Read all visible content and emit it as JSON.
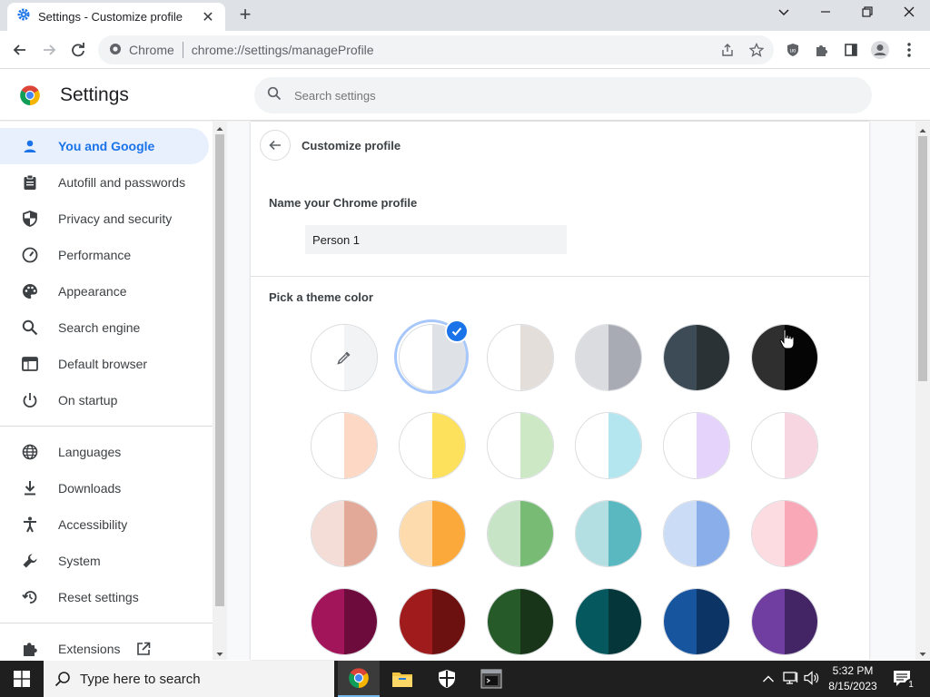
{
  "window": {
    "tab_title": "Settings - Customize profile",
    "tab_close": "✕",
    "new_tab": "+",
    "minimize": "⌄",
    "maximize": "—",
    "restore": "❐",
    "close": "✕"
  },
  "toolbar": {
    "chip_label": "Chrome",
    "url_scheme": "chrome://",
    "url_path": "settings/manageProfile"
  },
  "settings": {
    "title": "Settings",
    "search_placeholder": "Search settings"
  },
  "sidebar": {
    "items": [
      {
        "label": "You and Google",
        "icon": "person-icon",
        "active": true
      },
      {
        "label": "Autofill and passwords",
        "icon": "clipboard-icon"
      },
      {
        "label": "Privacy and security",
        "icon": "shield-icon"
      },
      {
        "label": "Performance",
        "icon": "gauge-icon"
      },
      {
        "label": "Appearance",
        "icon": "palette-icon"
      },
      {
        "label": "Search engine",
        "icon": "search-icon"
      },
      {
        "label": "Default browser",
        "icon": "browser-icon"
      },
      {
        "label": "On startup",
        "icon": "power-icon"
      },
      {
        "label": "Languages",
        "icon": "globe-icon"
      },
      {
        "label": "Downloads",
        "icon": "download-icon"
      },
      {
        "label": "Accessibility",
        "icon": "accessibility-icon"
      },
      {
        "label": "System",
        "icon": "wrench-icon"
      },
      {
        "label": "Reset settings",
        "icon": "reset-icon"
      },
      {
        "label": "Extensions",
        "icon": "puzzle-icon"
      }
    ]
  },
  "main": {
    "heading": "Customize profile",
    "name_label": "Name your Chrome profile",
    "name_value": "Person 1",
    "color_label": "Pick a theme color",
    "colors": [
      {
        "name": "custom",
        "left": "#ffffff",
        "right": "#f1f3f4"
      },
      {
        "name": "default",
        "left": "#ffffff",
        "right": "#dee1e6",
        "selected": true
      },
      {
        "name": "warm-grey",
        "left": "#ffffff",
        "right": "#e3ded9"
      },
      {
        "name": "cool-grey",
        "left": "#dadce0",
        "right": "#a8abb4"
      },
      {
        "name": "slate",
        "left": "#3d4b57",
        "right": "#2a3236"
      },
      {
        "name": "black",
        "left": "#2f2f2f",
        "right": "#050505"
      },
      {
        "name": "peach-light",
        "left": "#ffffff",
        "right": "#fdd8c5"
      },
      {
        "name": "yellow-light",
        "left": "#ffffff",
        "right": "#fde05b"
      },
      {
        "name": "green-light",
        "left": "#ffffff",
        "right": "#cde8c5"
      },
      {
        "name": "cyan-light",
        "left": "#ffffff",
        "right": "#b3e6ef"
      },
      {
        "name": "lavender-light",
        "left": "#ffffff",
        "right": "#e6d3fc"
      },
      {
        "name": "pink-light",
        "left": "#ffffff",
        "right": "#f7d6e2"
      },
      {
        "name": "rose",
        "left": "#f4ddd6",
        "right": "#e2a998"
      },
      {
        "name": "orange",
        "left": "#fddbad",
        "right": "#fba93a"
      },
      {
        "name": "green",
        "left": "#c7e5c6",
        "right": "#77bb75"
      },
      {
        "name": "teal",
        "left": "#b3dfe2",
        "right": "#5ab8c1"
      },
      {
        "name": "blue",
        "left": "#cbdcf6",
        "right": "#89aee9"
      },
      {
        "name": "pink",
        "left": "#fcdbe1",
        "right": "#f8a8b6"
      },
      {
        "name": "magenta",
        "left": "#a3155a",
        "right": "#6d0c3c"
      },
      {
        "name": "red",
        "left": "#a01c1c",
        "right": "#6d1010"
      },
      {
        "name": "forest",
        "left": "#265a28",
        "right": "#18351a"
      },
      {
        "name": "dark-teal",
        "left": "#05595e",
        "right": "#053639"
      },
      {
        "name": "navy",
        "left": "#17569f",
        "right": "#0c3566"
      },
      {
        "name": "purple",
        "left": "#703ea0",
        "right": "#432566"
      }
    ]
  },
  "taskbar": {
    "search_placeholder": "Type here to search",
    "time": "5:32 PM",
    "date": "8/15/2023",
    "notification_count": "1"
  },
  "colors": {
    "accent": "#1a73e8",
    "active_bg": "#e8f0fe"
  }
}
